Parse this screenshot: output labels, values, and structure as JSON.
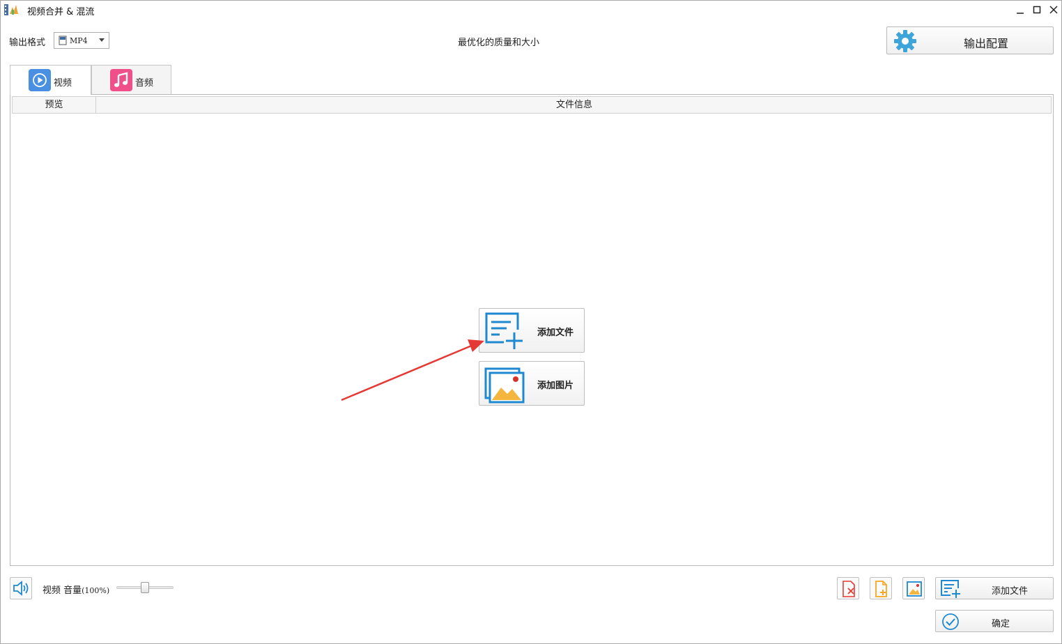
{
  "window": {
    "title": "视频合并 & 混流",
    "app_icon": "film-strip-icon",
    "controls": [
      "minimize-icon",
      "maximize-icon",
      "close-icon"
    ]
  },
  "toolbar": {
    "format_label": "输出格式",
    "format_value": "MP4",
    "quality_text": "最优化的质量和大小",
    "output_config_label": "输出配置"
  },
  "tabs": [
    {
      "label": "视频",
      "icon": "play-icon",
      "active": true,
      "color": "#4a90e2"
    },
    {
      "label": "音频",
      "icon": "music-note-icon",
      "active": false,
      "color": "#f0508a"
    }
  ],
  "list": {
    "columns": [
      "预览",
      "文件信息"
    ],
    "rows": []
  },
  "center_actions": {
    "add_file_label": "添加文件",
    "add_image_label": "添加图片"
  },
  "bottom": {
    "volume_label": "视频 音量",
    "volume_percent": "(100%)",
    "volume_level": 0.5,
    "add_file_label": "添加文件",
    "confirm_label": "确定"
  },
  "colors": {
    "accent_blue": "#1e88d1",
    "accent_red": "#e53935",
    "accent_orange": "#f5a623"
  }
}
